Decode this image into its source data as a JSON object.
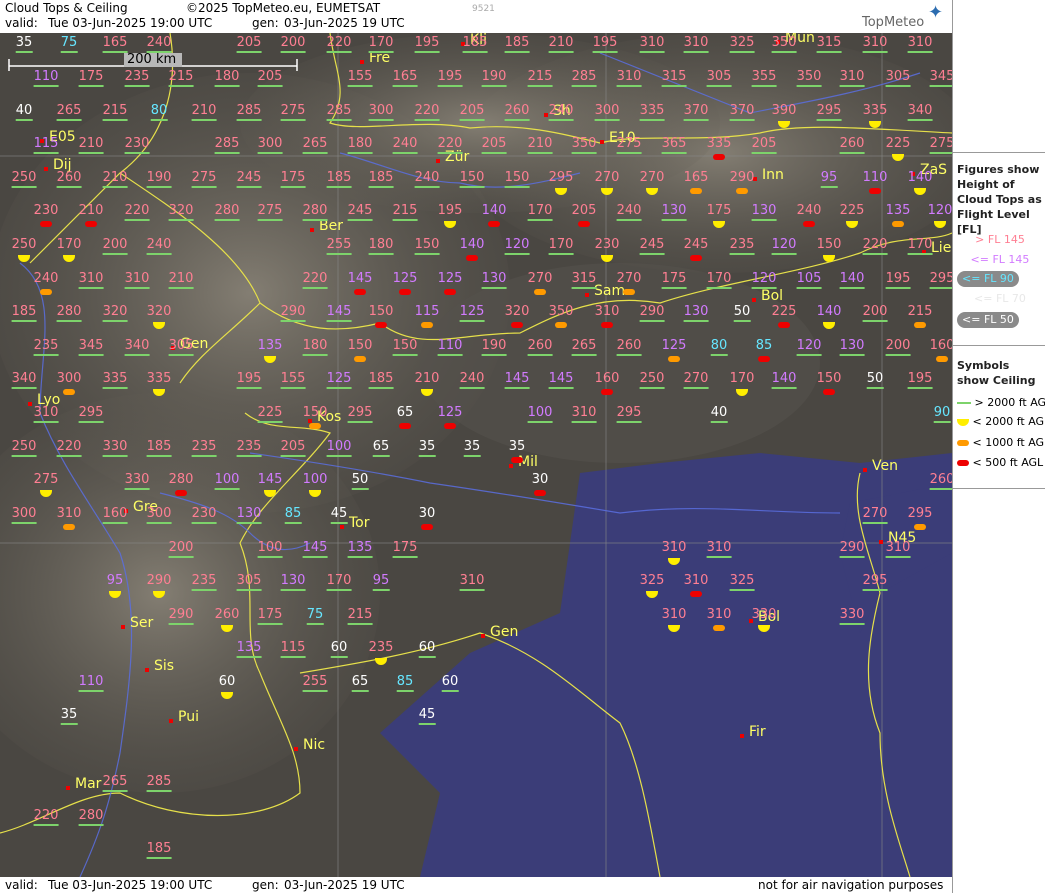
{
  "header": {
    "title": "Cloud Tops & Ceiling",
    "copyright": "©2025 TopMeteo.eu, EUMETSAT",
    "valid_label": "valid:",
    "valid_value": "Tue   03-Jun-2025   19:00 UTC",
    "gen_label": "gen:",
    "gen_value": "03-Jun-2025 19 UTC",
    "code": "9521",
    "logo": "TopMeteo"
  },
  "footer": {
    "valid_label": "valid:",
    "valid_value": "Tue   03-Jun-2025   19:00 UTC",
    "gen_label": "gen:",
    "gen_value": "03-Jun-2025 19 UTC",
    "disclaimer": "not for air navigation purposes"
  },
  "scale": {
    "label": "200 km"
  },
  "legend": {
    "figures_title": "Figures show Height of Cloud Tops as Flight Level  [FL]",
    "figures": [
      {
        "label": "> FL 145",
        "color": "#ff7f93"
      },
      {
        "label": "<= FL 145",
        "color": "#d27bff"
      },
      {
        "label": "<= FL 90",
        "color": "#66e6ff"
      },
      {
        "label": "<= FL 70",
        "color": "#ffffff"
      },
      {
        "label": "<= FL 50",
        "color": "#ffffff"
      }
    ],
    "symbols_title": "Symbols show Ceiling",
    "symbols": [
      {
        "label": "> 2000 ft AGL",
        "color": "#7dd36b",
        "shape": "line"
      },
      {
        "label": "< 2000 ft AGL",
        "color": "#ffee00",
        "shape": "half-disc"
      },
      {
        "label": "< 1000 ft AGL",
        "color": "#ff9a00",
        "shape": "bar"
      },
      {
        "label": "< 500 ft AGL",
        "color": "#ee0000",
        "shape": "bar"
      }
    ]
  },
  "cities": [
    "Fre",
    "Mun",
    "Kli",
    "Sh",
    "E05",
    "E10",
    "Dij",
    "Zür",
    "Inn",
    "ZaS",
    "Ber",
    "Lie",
    "Sam",
    "Bol",
    "Gen",
    "Lyo",
    "Kos",
    "Mil",
    "Ven",
    "Gre",
    "Tor",
    "N45",
    "Ser",
    "Gen",
    "Bol",
    "Sis",
    "Pui",
    "Nic",
    "Fir",
    "Mar"
  ],
  "cloud_tops": [
    {
      "v": "35",
      "c": "white"
    },
    {
      "v": "75",
      "c": "cyan"
    },
    {
      "v": "165",
      "c": "pink"
    },
    {
      "v": "240",
      "c": "pink"
    },
    {
      "v": "205",
      "c": "pink"
    },
    {
      "v": "200",
      "c": "pink"
    },
    {
      "v": "220",
      "c": "pink"
    },
    {
      "v": "170",
      "c": "pink"
    },
    {
      "v": "195",
      "c": "pink"
    },
    {
      "v": "185",
      "c": "pink"
    },
    {
      "v": "185",
      "c": "pink"
    },
    {
      "v": "210",
      "c": "pink"
    },
    {
      "v": "195",
      "c": "pink"
    },
    {
      "v": "310",
      "c": "pink"
    },
    {
      "v": "310",
      "c": "pink"
    },
    {
      "v": "325",
      "c": "pink"
    },
    {
      "v": "350",
      "c": "pink"
    },
    {
      "v": "315",
      "c": "pink"
    },
    {
      "v": "310",
      "c": "pink"
    },
    {
      "v": "310",
      "c": "pink"
    },
    {
      "v": "110",
      "c": "purple"
    },
    {
      "v": "175",
      "c": "pink"
    },
    {
      "v": "235",
      "c": "pink"
    },
    {
      "v": "215",
      "c": "pink"
    },
    {
      "v": "180",
      "c": "pink"
    },
    {
      "v": "205",
      "c": "pink"
    },
    {
      "v": "155",
      "c": "pink"
    },
    {
      "v": "165",
      "c": "pink"
    },
    {
      "v": "195",
      "c": "pink"
    },
    {
      "v": "190",
      "c": "pink"
    },
    {
      "v": "215",
      "c": "pink"
    },
    {
      "v": "285",
      "c": "pink"
    },
    {
      "v": "310",
      "c": "pink"
    },
    {
      "v": "315",
      "c": "pink"
    },
    {
      "v": "305",
      "c": "pink"
    },
    {
      "v": "355",
      "c": "pink"
    },
    {
      "v": "350",
      "c": "pink"
    },
    {
      "v": "310",
      "c": "pink"
    },
    {
      "v": "305",
      "c": "pink"
    },
    {
      "v": "345",
      "c": "pink"
    },
    {
      "v": "40",
      "c": "white"
    },
    {
      "v": "265",
      "c": "pink"
    },
    {
      "v": "215",
      "c": "pink"
    },
    {
      "v": "80",
      "c": "cyan"
    },
    {
      "v": "210",
      "c": "pink"
    },
    {
      "v": "285",
      "c": "pink"
    },
    {
      "v": "275",
      "c": "pink"
    },
    {
      "v": "285",
      "c": "pink"
    },
    {
      "v": "300",
      "c": "pink"
    },
    {
      "v": "220",
      "c": "pink"
    },
    {
      "v": "205",
      "c": "pink"
    },
    {
      "v": "260",
      "c": "pink"
    },
    {
      "v": "240",
      "c": "pink"
    },
    {
      "v": "300",
      "c": "pink"
    },
    {
      "v": "335",
      "c": "pink"
    },
    {
      "v": "370",
      "c": "pink"
    },
    {
      "v": "370",
      "c": "pink"
    },
    {
      "v": "390",
      "c": "pink"
    },
    {
      "v": "295",
      "c": "pink"
    },
    {
      "v": "335",
      "c": "pink"
    },
    {
      "v": "340",
      "c": "pink"
    },
    {
      "v": "115",
      "c": "purple"
    },
    {
      "v": "210",
      "c": "pink"
    },
    {
      "v": "230",
      "c": "pink"
    },
    {
      "v": "285",
      "c": "pink"
    },
    {
      "v": "300",
      "c": "pink"
    },
    {
      "v": "265",
      "c": "pink"
    },
    {
      "v": "180",
      "c": "pink"
    },
    {
      "v": "240",
      "c": "pink"
    },
    {
      "v": "220",
      "c": "pink"
    },
    {
      "v": "205",
      "c": "pink"
    },
    {
      "v": "210",
      "c": "pink"
    },
    {
      "v": "350",
      "c": "pink"
    },
    {
      "v": "275",
      "c": "pink"
    },
    {
      "v": "365",
      "c": "pink"
    },
    {
      "v": "335",
      "c": "pink"
    },
    {
      "v": "205",
      "c": "pink"
    },
    {
      "v": "260",
      "c": "pink"
    },
    {
      "v": "225",
      "c": "pink"
    },
    {
      "v": "275",
      "c": "pink"
    },
    {
      "v": "250",
      "c": "pink"
    },
    {
      "v": "260",
      "c": "pink"
    },
    {
      "v": "210",
      "c": "pink"
    },
    {
      "v": "190",
      "c": "pink"
    },
    {
      "v": "275",
      "c": "pink"
    },
    {
      "v": "245",
      "c": "pink"
    },
    {
      "v": "175",
      "c": "pink"
    },
    {
      "v": "185",
      "c": "pink"
    },
    {
      "v": "185",
      "c": "pink"
    },
    {
      "v": "240",
      "c": "pink"
    },
    {
      "v": "150",
      "c": "pink"
    },
    {
      "v": "150",
      "c": "pink"
    },
    {
      "v": "295",
      "c": "pink"
    },
    {
      "v": "270",
      "c": "pink"
    },
    {
      "v": "270",
      "c": "pink"
    },
    {
      "v": "165",
      "c": "pink"
    },
    {
      "v": "290",
      "c": "pink"
    },
    {
      "v": "95",
      "c": "purple"
    },
    {
      "v": "110",
      "c": "purple"
    },
    {
      "v": "140",
      "c": "purple"
    },
    {
      "v": "230",
      "c": "pink"
    },
    {
      "v": "210",
      "c": "pink"
    },
    {
      "v": "220",
      "c": "pink"
    },
    {
      "v": "320",
      "c": "pink"
    },
    {
      "v": "280",
      "c": "pink"
    },
    {
      "v": "275",
      "c": "pink"
    },
    {
      "v": "280",
      "c": "pink"
    },
    {
      "v": "245",
      "c": "pink"
    },
    {
      "v": "215",
      "c": "pink"
    },
    {
      "v": "195",
      "c": "pink"
    },
    {
      "v": "140",
      "c": "purple"
    },
    {
      "v": "170",
      "c": "pink"
    },
    {
      "v": "205",
      "c": "pink"
    },
    {
      "v": "240",
      "c": "pink"
    },
    {
      "v": "130",
      "c": "purple"
    },
    {
      "v": "175",
      "c": "pink"
    },
    {
      "v": "130",
      "c": "purple"
    },
    {
      "v": "240",
      "c": "pink"
    },
    {
      "v": "225",
      "c": "pink"
    },
    {
      "v": "135",
      "c": "purple"
    },
    {
      "v": "120",
      "c": "purple"
    },
    {
      "v": "250",
      "c": "pink"
    },
    {
      "v": "170",
      "c": "pink"
    },
    {
      "v": "200",
      "c": "pink"
    },
    {
      "v": "240",
      "c": "pink"
    },
    {
      "v": "255",
      "c": "pink"
    },
    {
      "v": "180",
      "c": "pink"
    },
    {
      "v": "150",
      "c": "pink"
    },
    {
      "v": "140",
      "c": "purple"
    },
    {
      "v": "120",
      "c": "purple"
    },
    {
      "v": "170",
      "c": "pink"
    },
    {
      "v": "230",
      "c": "pink"
    },
    {
      "v": "245",
      "c": "pink"
    },
    {
      "v": "245",
      "c": "pink"
    },
    {
      "v": "235",
      "c": "pink"
    },
    {
      "v": "120",
      "c": "purple"
    },
    {
      "v": "150",
      "c": "pink"
    },
    {
      "v": "220",
      "c": "pink"
    },
    {
      "v": "170",
      "c": "pink"
    },
    {
      "v": "240",
      "c": "pink"
    },
    {
      "v": "310",
      "c": "pink"
    },
    {
      "v": "310",
      "c": "pink"
    },
    {
      "v": "210",
      "c": "pink"
    },
    {
      "v": "220",
      "c": "pink"
    },
    {
      "v": "145",
      "c": "purple"
    },
    {
      "v": "125",
      "c": "purple"
    },
    {
      "v": "125",
      "c": "purple"
    },
    {
      "v": "130",
      "c": "purple"
    },
    {
      "v": "270",
      "c": "pink"
    },
    {
      "v": "315",
      "c": "pink"
    },
    {
      "v": "270",
      "c": "pink"
    },
    {
      "v": "175",
      "c": "pink"
    },
    {
      "v": "170",
      "c": "pink"
    },
    {
      "v": "120",
      "c": "purple"
    },
    {
      "v": "105",
      "c": "purple"
    },
    {
      "v": "140",
      "c": "purple"
    },
    {
      "v": "195",
      "c": "pink"
    },
    {
      "v": "295",
      "c": "pink"
    },
    {
      "v": "185",
      "c": "pink"
    },
    {
      "v": "280",
      "c": "pink"
    },
    {
      "v": "320",
      "c": "pink"
    },
    {
      "v": "320",
      "c": "pink"
    },
    {
      "v": "290",
      "c": "pink"
    },
    {
      "v": "145",
      "c": "purple"
    },
    {
      "v": "150",
      "c": "pink"
    },
    {
      "v": "115",
      "c": "purple"
    },
    {
      "v": "125",
      "c": "purple"
    },
    {
      "v": "320",
      "c": "pink"
    },
    {
      "v": "350",
      "c": "pink"
    },
    {
      "v": "310",
      "c": "pink"
    },
    {
      "v": "290",
      "c": "pink"
    },
    {
      "v": "130",
      "c": "purple"
    },
    {
      "v": "50",
      "c": "white"
    },
    {
      "v": "225",
      "c": "pink"
    },
    {
      "v": "140",
      "c": "purple"
    },
    {
      "v": "200",
      "c": "pink"
    },
    {
      "v": "215",
      "c": "pink"
    },
    {
      "v": "235",
      "c": "pink"
    },
    {
      "v": "345",
      "c": "pink"
    },
    {
      "v": "340",
      "c": "pink"
    },
    {
      "v": "305",
      "c": "pink"
    },
    {
      "v": "135",
      "c": "purple"
    },
    {
      "v": "180",
      "c": "pink"
    },
    {
      "v": "150",
      "c": "pink"
    },
    {
      "v": "150",
      "c": "pink"
    },
    {
      "v": "110",
      "c": "purple"
    },
    {
      "v": "190",
      "c": "pink"
    },
    {
      "v": "260",
      "c": "pink"
    },
    {
      "v": "265",
      "c": "pink"
    },
    {
      "v": "260",
      "c": "pink"
    },
    {
      "v": "125",
      "c": "purple"
    },
    {
      "v": "80",
      "c": "cyan"
    },
    {
      "v": "85",
      "c": "cyan"
    },
    {
      "v": "120",
      "c": "purple"
    },
    {
      "v": "130",
      "c": "purple"
    },
    {
      "v": "200",
      "c": "pink"
    },
    {
      "v": "160",
      "c": "pink"
    },
    {
      "v": "340",
      "c": "pink"
    },
    {
      "v": "300",
      "c": "pink"
    },
    {
      "v": "335",
      "c": "pink"
    },
    {
      "v": "335",
      "c": "pink"
    },
    {
      "v": "195",
      "c": "pink"
    },
    {
      "v": "155",
      "c": "pink"
    },
    {
      "v": "125",
      "c": "purple"
    },
    {
      "v": "185",
      "c": "pink"
    },
    {
      "v": "210",
      "c": "pink"
    },
    {
      "v": "240",
      "c": "pink"
    },
    {
      "v": "145",
      "c": "purple"
    },
    {
      "v": "145",
      "c": "purple"
    },
    {
      "v": "160",
      "c": "pink"
    },
    {
      "v": "250",
      "c": "pink"
    },
    {
      "v": "270",
      "c": "pink"
    },
    {
      "v": "170",
      "c": "pink"
    },
    {
      "v": "140",
      "c": "purple"
    },
    {
      "v": "150",
      "c": "pink"
    },
    {
      "v": "50",
      "c": "white"
    },
    {
      "v": "195",
      "c": "pink"
    },
    {
      "v": "310",
      "c": "pink"
    },
    {
      "v": "295",
      "c": "pink"
    },
    {
      "v": "225",
      "c": "pink"
    },
    {
      "v": "150",
      "c": "pink"
    },
    {
      "v": "295",
      "c": "pink"
    },
    {
      "v": "65",
      "c": "white"
    },
    {
      "v": "125",
      "c": "purple"
    },
    {
      "v": "100",
      "c": "purple"
    },
    {
      "v": "310",
      "c": "pink"
    },
    {
      "v": "295",
      "c": "pink"
    },
    {
      "v": "40",
      "c": "white"
    },
    {
      "v": "90",
      "c": "cyan"
    },
    {
      "v": "250",
      "c": "pink"
    },
    {
      "v": "220",
      "c": "pink"
    },
    {
      "v": "330",
      "c": "pink"
    },
    {
      "v": "185",
      "c": "pink"
    },
    {
      "v": "235",
      "c": "pink"
    },
    {
      "v": "235",
      "c": "pink"
    },
    {
      "v": "205",
      "c": "pink"
    },
    {
      "v": "100",
      "c": "purple"
    },
    {
      "v": "65",
      "c": "white"
    },
    {
      "v": "35",
      "c": "white"
    },
    {
      "v": "35",
      "c": "white"
    },
    {
      "v": "35",
      "c": "white"
    },
    {
      "v": "275",
      "c": "pink"
    },
    {
      "v": "330",
      "c": "pink"
    },
    {
      "v": "280",
      "c": "pink"
    },
    {
      "v": "100",
      "c": "purple"
    },
    {
      "v": "145",
      "c": "purple"
    },
    {
      "v": "100",
      "c": "purple"
    },
    {
      "v": "50",
      "c": "white"
    },
    {
      "v": "30",
      "c": "white"
    },
    {
      "v": "260",
      "c": "pink"
    },
    {
      "v": "300",
      "c": "pink"
    },
    {
      "v": "310",
      "c": "pink"
    },
    {
      "v": "160",
      "c": "pink"
    },
    {
      "v": "300",
      "c": "pink"
    },
    {
      "v": "230",
      "c": "pink"
    },
    {
      "v": "130",
      "c": "purple"
    },
    {
      "v": "85",
      "c": "cyan"
    },
    {
      "v": "45",
      "c": "white"
    },
    {
      "v": "30",
      "c": "white"
    },
    {
      "v": "270",
      "c": "pink"
    },
    {
      "v": "295",
      "c": "pink"
    },
    {
      "v": "200",
      "c": "pink"
    },
    {
      "v": "100",
      "c": "pink"
    },
    {
      "v": "145",
      "c": "purple"
    },
    {
      "v": "135",
      "c": "purple"
    },
    {
      "v": "175",
      "c": "pink"
    },
    {
      "v": "310",
      "c": "pink"
    },
    {
      "v": "310",
      "c": "pink"
    },
    {
      "v": "290",
      "c": "pink"
    },
    {
      "v": "310",
      "c": "pink"
    },
    {
      "v": "95",
      "c": "purple"
    },
    {
      "v": "290",
      "c": "pink"
    },
    {
      "v": "235",
      "c": "pink"
    },
    {
      "v": "305",
      "c": "pink"
    },
    {
      "v": "130",
      "c": "purple"
    },
    {
      "v": "170",
      "c": "pink"
    },
    {
      "v": "95",
      "c": "purple"
    },
    {
      "v": "310",
      "c": "pink"
    },
    {
      "v": "325",
      "c": "pink"
    },
    {
      "v": "310",
      "c": "pink"
    },
    {
      "v": "325",
      "c": "pink"
    },
    {
      "v": "295",
      "c": "pink"
    },
    {
      "v": "290",
      "c": "pink"
    },
    {
      "v": "260",
      "c": "pink"
    },
    {
      "v": "175",
      "c": "pink"
    },
    {
      "v": "75",
      "c": "cyan"
    },
    {
      "v": "215",
      "c": "pink"
    },
    {
      "v": "310",
      "c": "pink"
    },
    {
      "v": "310",
      "c": "pink"
    },
    {
      "v": "330",
      "c": "pink"
    },
    {
      "v": "330",
      "c": "pink"
    },
    {
      "v": "135",
      "c": "purple"
    },
    {
      "v": "115",
      "c": "pink"
    },
    {
      "v": "60",
      "c": "white"
    },
    {
      "v": "235",
      "c": "pink"
    },
    {
      "v": "60",
      "c": "white"
    },
    {
      "v": "110",
      "c": "purple"
    },
    {
      "v": "60",
      "c": "white"
    },
    {
      "v": "255",
      "c": "pink"
    },
    {
      "v": "65",
      "c": "white"
    },
    {
      "v": "85",
      "c": "cyan"
    },
    {
      "v": "60",
      "c": "white"
    },
    {
      "v": "35",
      "c": "white"
    },
    {
      "v": "45",
      "c": "white"
    },
    {
      "v": "265",
      "c": "pink"
    },
    {
      "v": "285",
      "c": "pink"
    },
    {
      "v": "220",
      "c": "pink"
    },
    {
      "v": "280",
      "c": "pink"
    },
    {
      "v": "185",
      "c": "pink"
    }
  ]
}
